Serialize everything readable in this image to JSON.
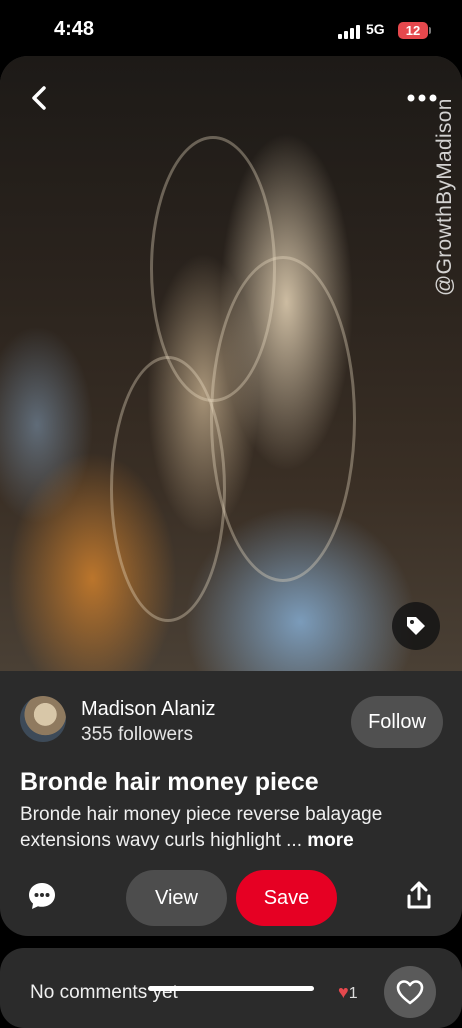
{
  "status_bar": {
    "time": "4:48",
    "network": "5G",
    "battery": "12"
  },
  "pin": {
    "watermark": "@GrowthByMadison",
    "author_name": "Madison Alaniz",
    "followers": "355 followers",
    "follow_label": "Follow",
    "title": "Bronde hair money piece",
    "description": "Bronde hair money piece reverse balayage extensions wavy curls highlight ...",
    "more_label": "more"
  },
  "actions": {
    "view_label": "View",
    "save_label": "Save"
  },
  "comments": {
    "label": "No comments yet",
    "reaction_count": "1"
  },
  "icons": {
    "back": "chevron-left-icon",
    "more": "more-horizontal-icon",
    "tag": "tag-icon",
    "comment": "comment-bubble-icon",
    "share": "share-upload-icon",
    "like": "heart-outline-icon"
  },
  "colors": {
    "accent": "#e60023",
    "surface": "#2b2b2b",
    "battery": "#e5484d"
  }
}
